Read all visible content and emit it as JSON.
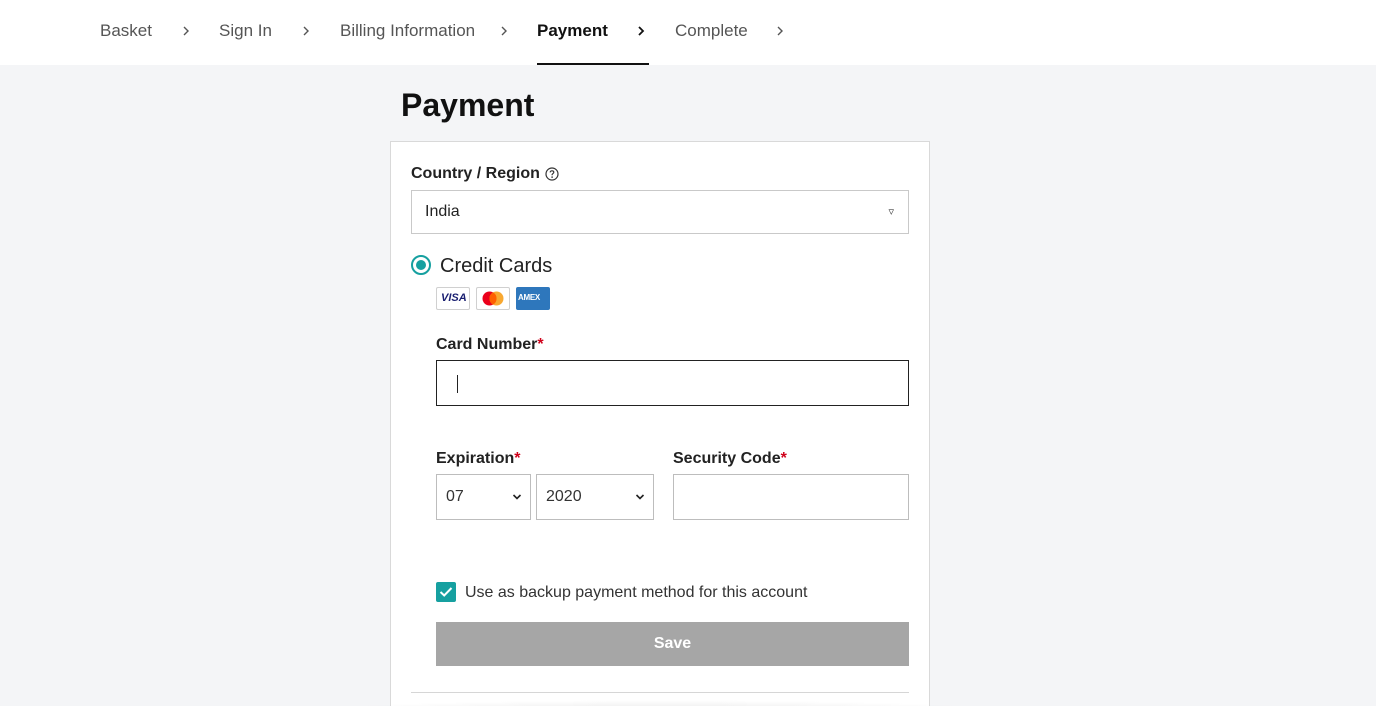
{
  "breadcrumb": {
    "steps": [
      {
        "label": "Basket"
      },
      {
        "label": "Sign In"
      },
      {
        "label": "Billing Information"
      },
      {
        "label": "Payment",
        "active": true
      },
      {
        "label": "Complete"
      }
    ]
  },
  "page": {
    "title": "Payment"
  },
  "form": {
    "country_label": "Country / Region",
    "country_value": "India",
    "payment_method_label": "Credit Cards",
    "payment_method_selected": true,
    "card_brands": [
      {
        "name": "VISA",
        "icon": "visa-logo"
      },
      {
        "name": "Mastercard",
        "icon": "mastercard-logo"
      },
      {
        "name": "AMEX",
        "icon": "amex-logo"
      }
    ],
    "card_number_label": "Card Number",
    "card_number_value": "",
    "expiration_label": "Expiration",
    "expiration_month": "07",
    "expiration_year": "2020",
    "security_code_label": "Security Code",
    "security_code_value": "",
    "required_marker": "*",
    "backup_label": "Use as backup payment method for this account",
    "backup_checked": true,
    "save_label": "Save"
  },
  "colors": {
    "accent": "#16a0a0",
    "required": "#d0021b",
    "disabled_button": "#a6a6a6",
    "background": "#f4f5f7"
  }
}
